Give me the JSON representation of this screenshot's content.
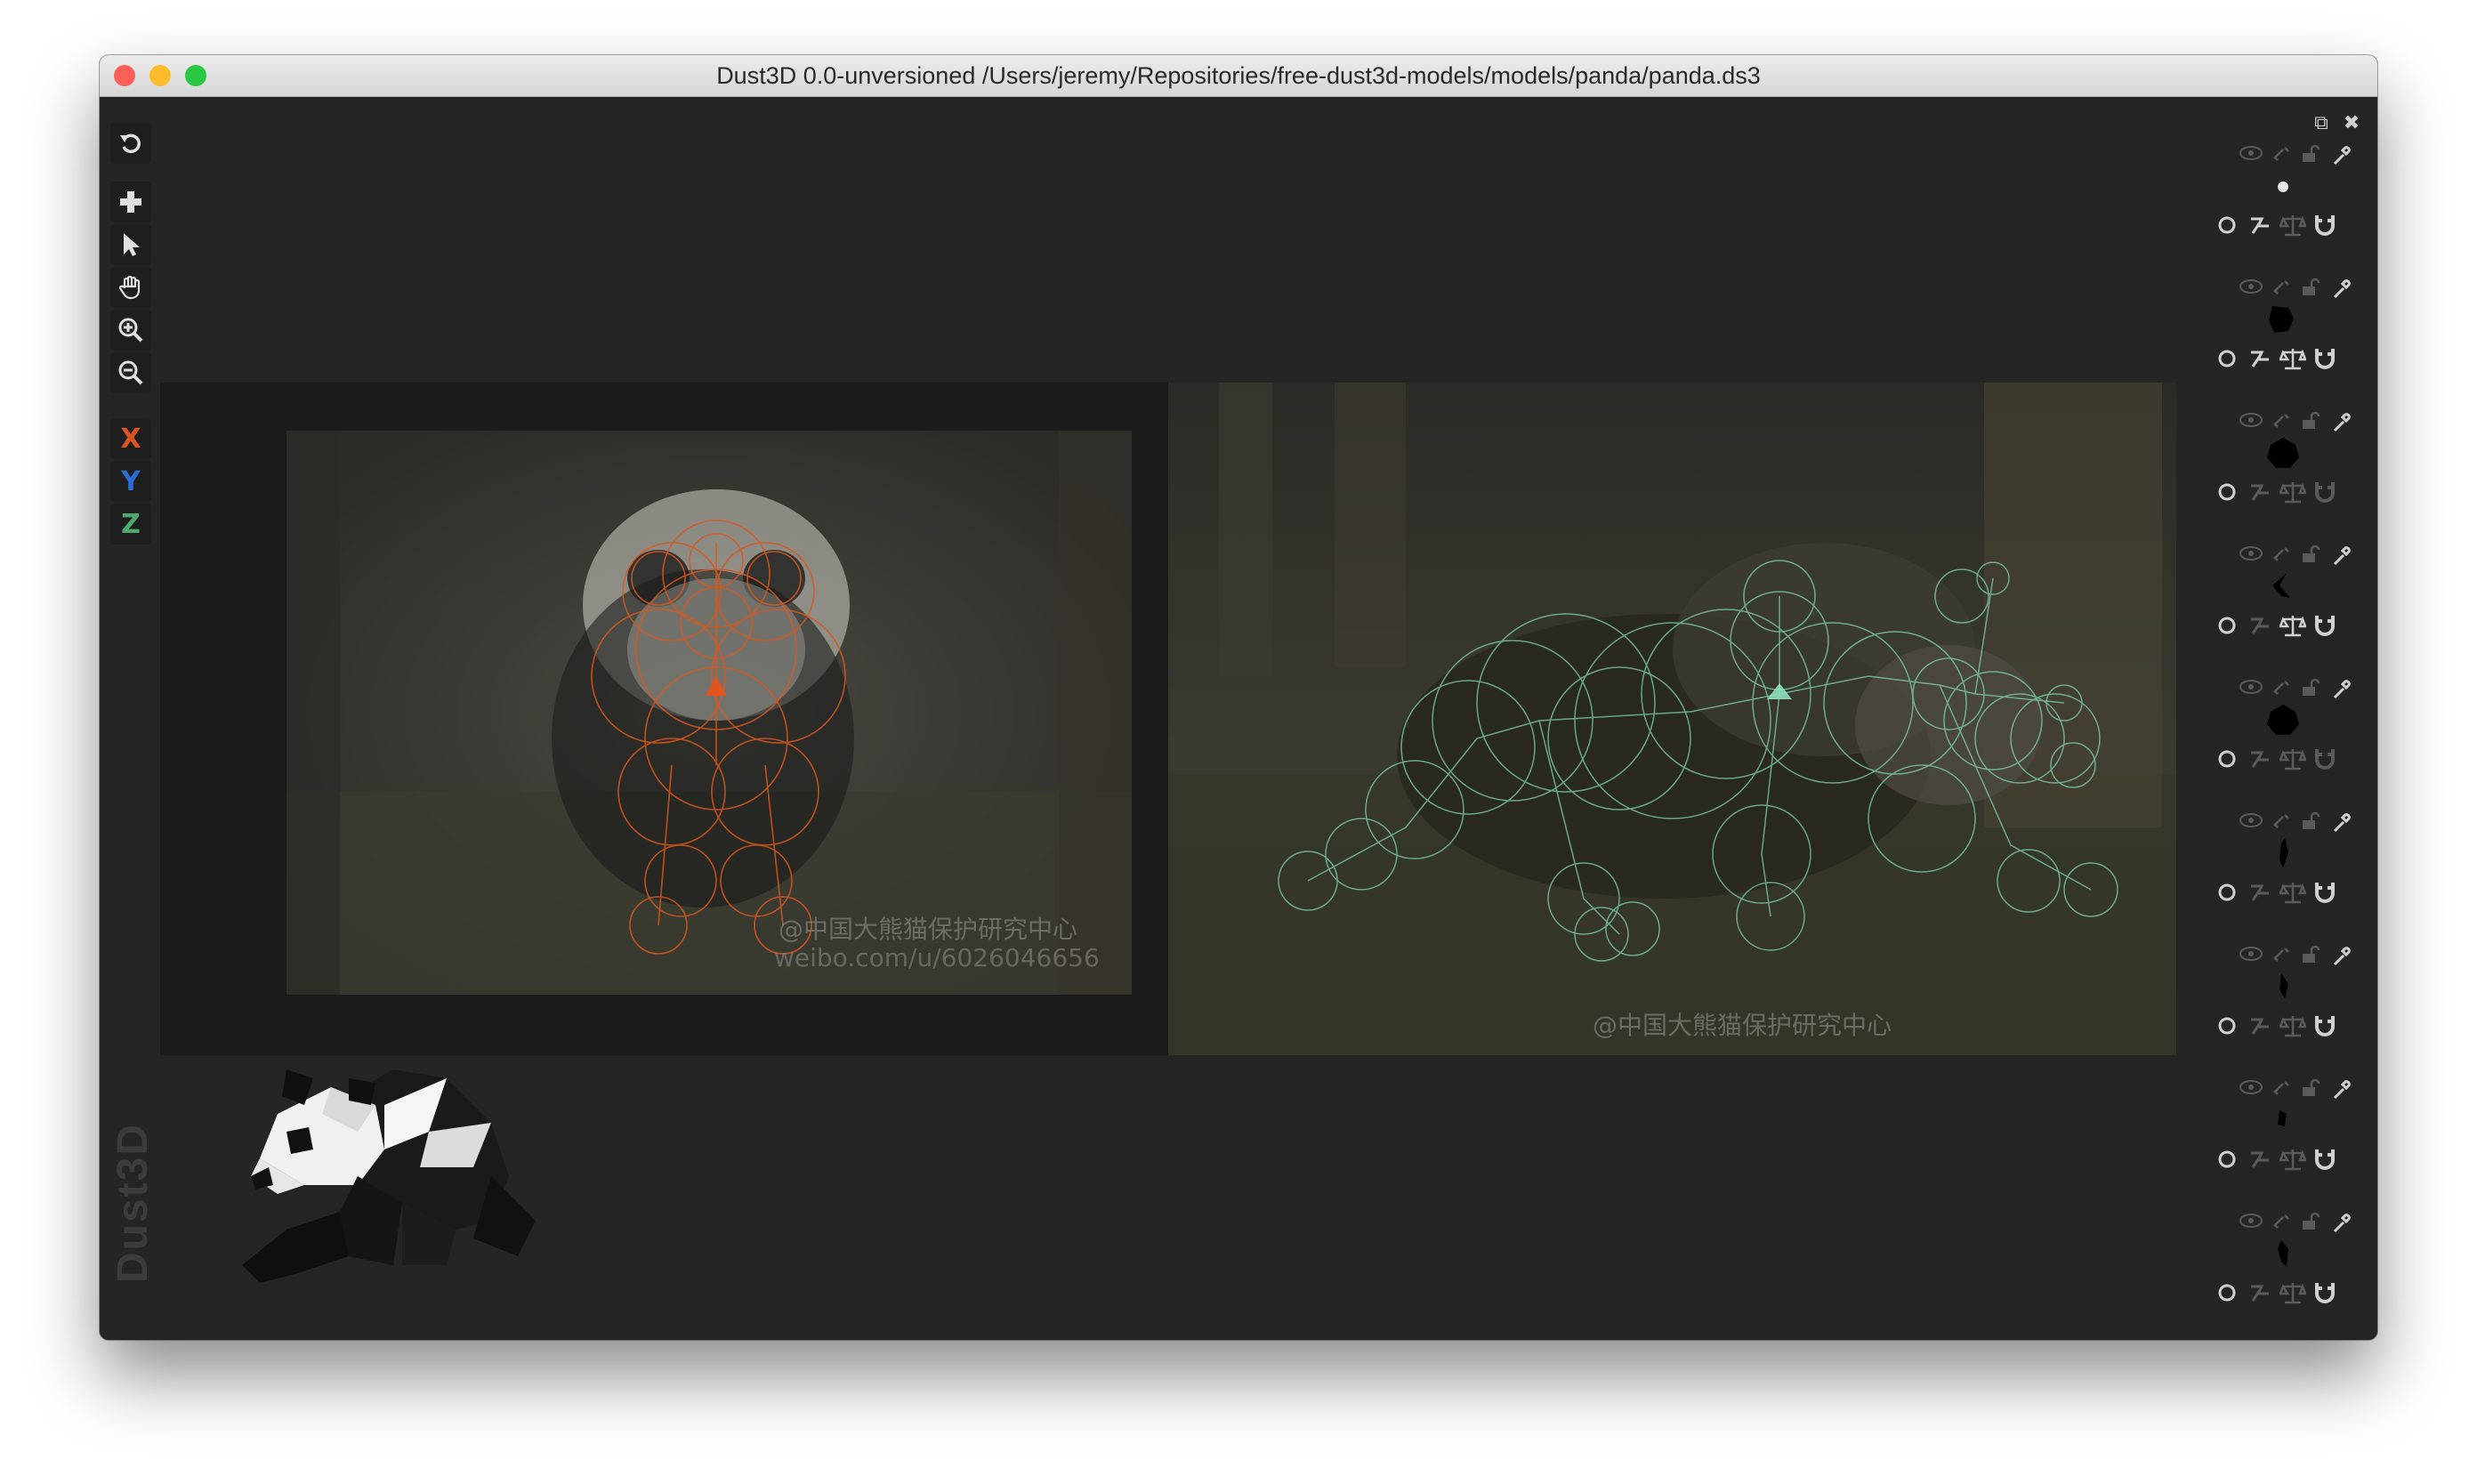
{
  "window": {
    "title": "Dust3D 0.0-unversioned /Users/jeremy/Repositories/free-dust3d-models/models/panda/panda.ds3",
    "traffic_lights": {
      "close": "#fc5f57",
      "minimize": "#fdbc2e",
      "zoom": "#28c840"
    }
  },
  "toolbar": {
    "tools": [
      {
        "name": "undo",
        "icon": "undo-icon"
      },
      {
        "name": "add",
        "icon": "plus-icon"
      },
      {
        "name": "select",
        "icon": "pointer-icon"
      },
      {
        "name": "drag",
        "icon": "hand-icon"
      },
      {
        "name": "zoom-in",
        "icon": "zoom-in-icon"
      },
      {
        "name": "zoom-out",
        "icon": "zoom-out-icon"
      }
    ],
    "axes": [
      {
        "label": "X",
        "color": "#e0531e"
      },
      {
        "label": "Y",
        "color": "#2a6bd6"
      },
      {
        "label": "Z",
        "color": "#4fa96a"
      }
    ]
  },
  "canvas": {
    "front_view": {
      "node_color": "#d9581d",
      "watermark_line1": "@中国大熊猫保护研究中心",
      "watermark_line2": "weibo.com/u/6026046656"
    },
    "side_view": {
      "node_color": "#7fd0b2",
      "watermark_line1": "@中国大熊猫保护研究中心"
    }
  },
  "branding": {
    "vertical_logo": "Dust3D"
  },
  "parts_panel": {
    "window_buttons": [
      "restore-icon",
      "close-icon"
    ],
    "parts": [
      {
        "id": 1,
        "mirror": true,
        "deform": false,
        "wrap": true
      },
      {
        "id": 2,
        "mirror": true,
        "deform": true,
        "wrap": true
      },
      {
        "id": 3,
        "mirror": false,
        "deform": false,
        "wrap": false
      },
      {
        "id": 4,
        "mirror": false,
        "deform": true,
        "wrap": true
      },
      {
        "id": 5,
        "mirror": false,
        "deform": false,
        "wrap": false
      },
      {
        "id": 6,
        "mirror": false,
        "deform": false,
        "wrap": true
      },
      {
        "id": 7,
        "mirror": false,
        "deform": false,
        "wrap": true
      },
      {
        "id": 8,
        "mirror": false,
        "deform": false,
        "wrap": true
      },
      {
        "id": 9,
        "mirror": false,
        "deform": false,
        "wrap": true
      }
    ]
  }
}
